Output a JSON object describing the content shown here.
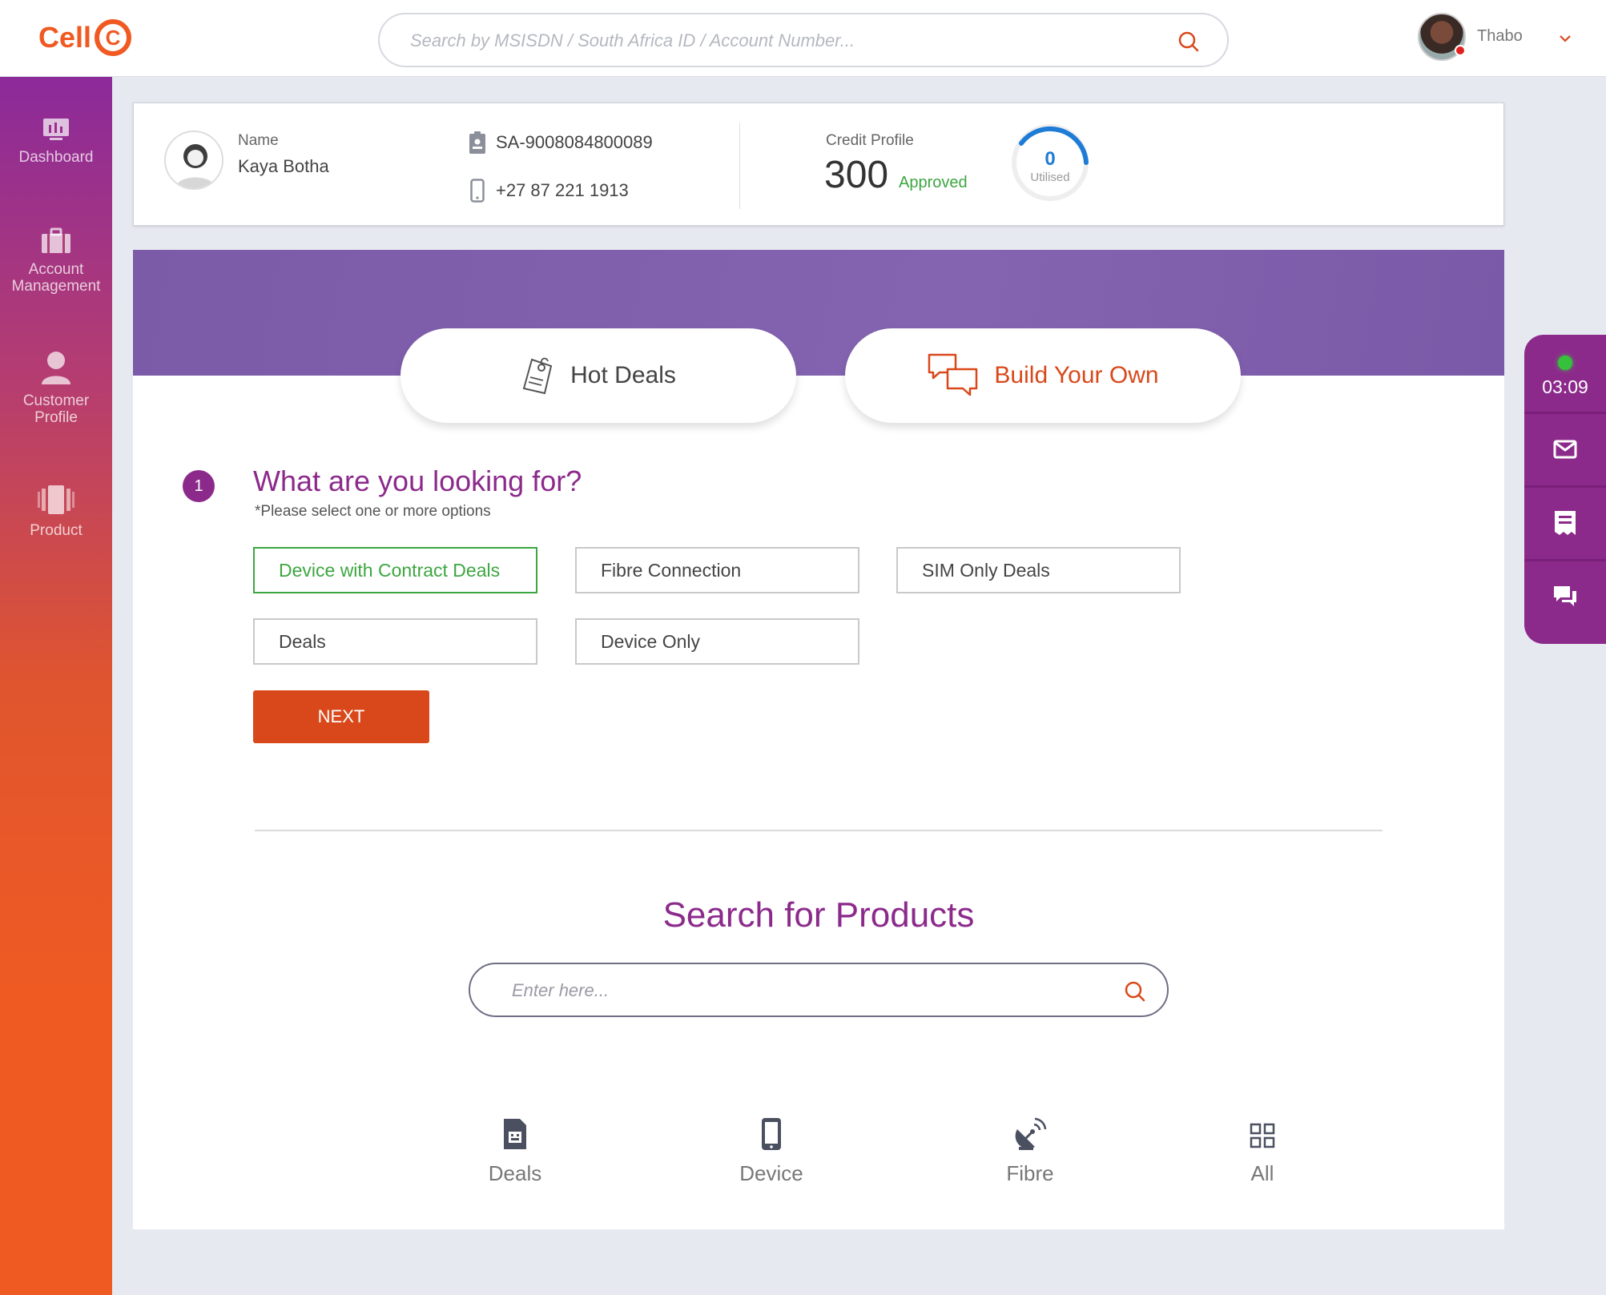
{
  "header": {
    "logo_text": "Cell",
    "logo_mark": "C",
    "search_placeholder": "Search by MSISDN / South Africa ID / Account Number...",
    "user_name": "Thabo"
  },
  "sidebar": {
    "items": [
      {
        "label": "Dashboard",
        "icon": "dashboard-icon"
      },
      {
        "label": "Account Management",
        "icon": "briefcase-icon"
      },
      {
        "label": "Customer Profile",
        "icon": "user-icon"
      },
      {
        "label": "Product",
        "icon": "product-icon"
      }
    ]
  },
  "customer": {
    "name_label": "Name",
    "name": "Kaya Botha",
    "id_number": "SA-9008084800089",
    "phone": "+27 87 221 1913",
    "credit_label": "Credit Profile",
    "credit_score": "300",
    "credit_status": "Approved",
    "utilised_value": "0",
    "utilised_label": "Utilised"
  },
  "deals": {
    "tabs": [
      {
        "label": "Hot Deals",
        "icon": "tag-icon"
      },
      {
        "label": "Build Your Own",
        "icon": "chat-bubbles-icon"
      }
    ]
  },
  "question": {
    "step": "1",
    "title": "What are you looking for?",
    "subtitle": "*Please select one or more options",
    "options": [
      {
        "label": "Device  with Contract Deals",
        "selected": true
      },
      {
        "label": "Fibre Connection",
        "selected": false
      },
      {
        "label": "SIM Only Deals",
        "selected": false
      },
      {
        "label": "Deals",
        "selected": false
      },
      {
        "label": "Device Only",
        "selected": false
      }
    ],
    "next_label": "NEXT"
  },
  "product_search": {
    "title": "Search for Products",
    "placeholder": "Enter here...",
    "categories": [
      {
        "label": "Deals",
        "icon": "sim-card-icon"
      },
      {
        "label": "Device",
        "icon": "phone-icon"
      },
      {
        "label": "Fibre",
        "icon": "satellite-dish-icon"
      },
      {
        "label": "All",
        "icon": "grid-icon"
      }
    ]
  },
  "dock": {
    "timer": "03:09",
    "buttons": [
      "mail-icon",
      "receipt-icon",
      "chat-icon"
    ]
  },
  "colors": {
    "brand_orange": "#f05a22",
    "brand_purple": "#8c2a8c",
    "cta_orange": "#d9481a",
    "selected_green": "#3da640",
    "gauge_blue": "#1f7cd6"
  }
}
